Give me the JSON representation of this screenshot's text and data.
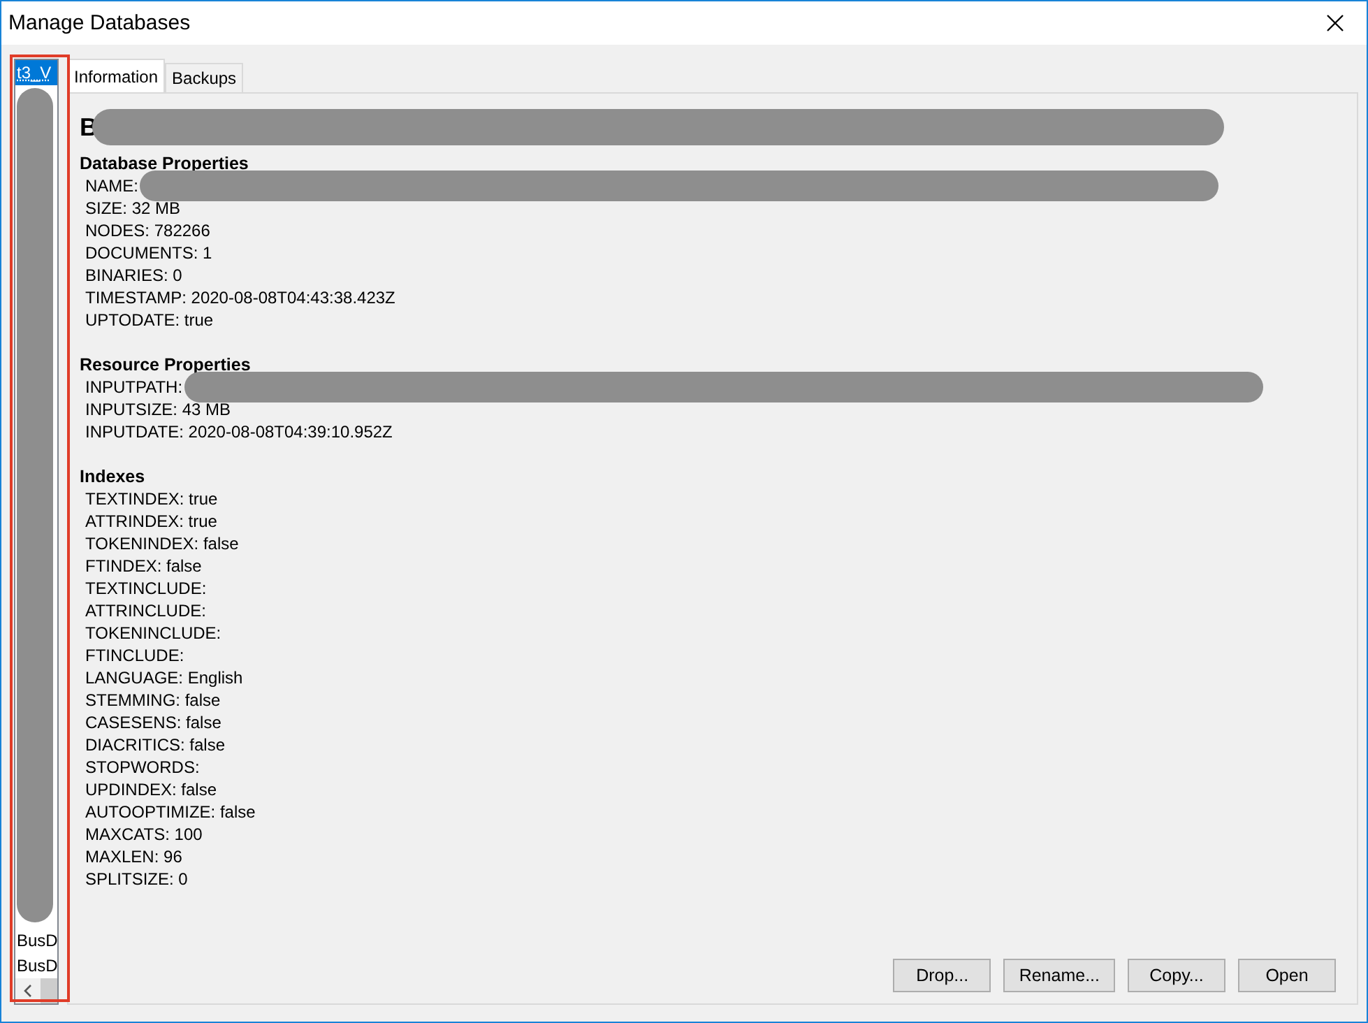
{
  "window": {
    "title": "Manage Databases"
  },
  "database_list": {
    "items": [
      {
        "label": "t3_V",
        "selected": true,
        "redacted": false
      },
      {
        "redacted": true
      },
      {
        "label": "BusD",
        "selected": false,
        "redacted": false
      },
      {
        "label": "BusD",
        "selected": false,
        "redacted": false
      }
    ]
  },
  "tabs": [
    {
      "label": "Information",
      "selected": true
    },
    {
      "label": "Backups",
      "selected": false
    }
  ],
  "information": {
    "heading": {
      "text": "B",
      "redacted": true
    },
    "sections": [
      {
        "title": "Database Properties",
        "lines": [
          {
            "text": "NAME:",
            "redacted": true
          },
          {
            "text": "SIZE: 32 MB",
            "redacted": false
          },
          {
            "text": "NODES: 782266",
            "redacted": false
          },
          {
            "text": "DOCUMENTS: 1",
            "redacted": false
          },
          {
            "text": "BINARIES: 0",
            "redacted": false
          },
          {
            "text": "TIMESTAMP: 2020-08-08T04:43:38.423Z",
            "redacted": false
          },
          {
            "text": "UPTODATE: true",
            "redacted": false
          }
        ]
      },
      {
        "title": "Resource Properties",
        "lines": [
          {
            "text": "INPUTPATH:",
            "redacted": true
          },
          {
            "text": "INPUTSIZE: 43 MB",
            "redacted": false
          },
          {
            "text": "INPUTDATE: 2020-08-08T04:39:10.952Z",
            "redacted": false
          }
        ]
      },
      {
        "title": "Indexes",
        "lines": [
          {
            "text": "TEXTINDEX: true",
            "redacted": false
          },
          {
            "text": "ATTRINDEX: true",
            "redacted": false
          },
          {
            "text": "TOKENINDEX: false",
            "redacted": false
          },
          {
            "text": "FTINDEX: false",
            "redacted": false
          },
          {
            "text": "TEXTINCLUDE:",
            "redacted": false
          },
          {
            "text": "ATTRINCLUDE:",
            "redacted": false
          },
          {
            "text": "TOKENINCLUDE:",
            "redacted": false
          },
          {
            "text": "FTINCLUDE:",
            "redacted": false
          },
          {
            "text": "LANGUAGE: English",
            "redacted": false
          },
          {
            "text": "STEMMING: false",
            "redacted": false
          },
          {
            "text": "CASESENS: false",
            "redacted": false
          },
          {
            "text": "DIACRITICS: false",
            "redacted": false
          },
          {
            "text": "STOPWORDS:",
            "redacted": false
          },
          {
            "text": "UPDINDEX: false",
            "redacted": false
          },
          {
            "text": "AUTOOPTIMIZE: false",
            "redacted": false
          },
          {
            "text": "MAXCATS: 100",
            "redacted": false
          },
          {
            "text": "MAXLEN: 96",
            "redacted": false
          },
          {
            "text": "SPLITSIZE: 0",
            "redacted": false
          }
        ]
      }
    ]
  },
  "buttons": [
    "Drop...",
    "Rename...",
    "Copy...",
    "Open"
  ]
}
